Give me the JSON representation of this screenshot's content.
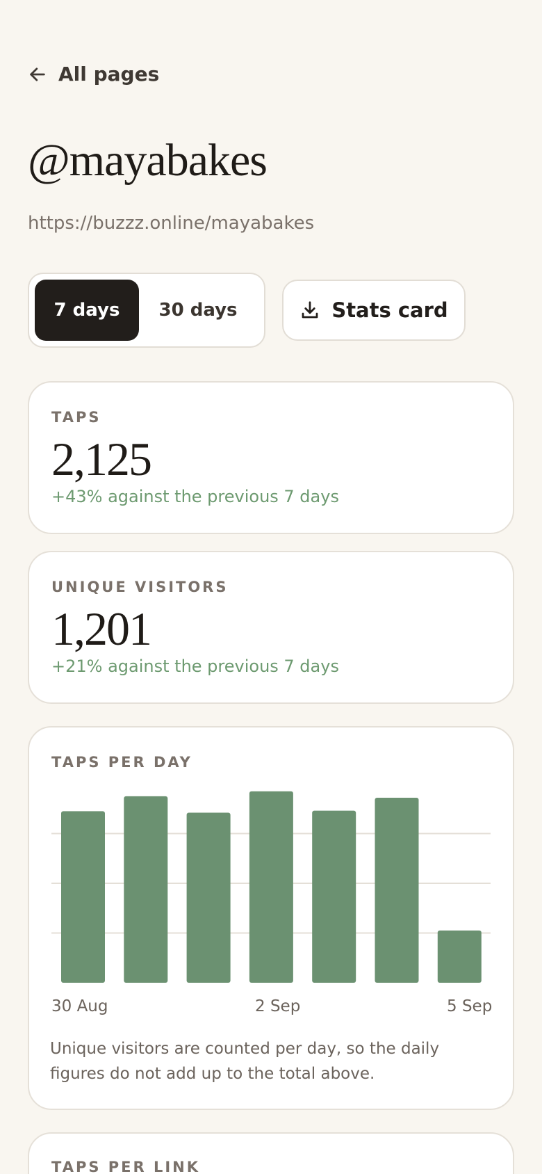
{
  "nav": {
    "back_label": "All pages"
  },
  "page": {
    "handle": "@mayabakes",
    "url": "https://buzzz.online/mayabakes"
  },
  "range": {
    "options": [
      "7 days",
      "30 days"
    ],
    "selected": "7 days"
  },
  "stats_card_button": "Stats card",
  "taps": {
    "label": "TAPS",
    "value": "2,125",
    "delta": "+43% against the previous 7 days"
  },
  "visitors": {
    "label": "UNIQUE VISITORS",
    "value": "1,201",
    "delta": "+21% against the previous 7 days"
  },
  "taps_per_day": {
    "label": "TAPS PER DAY",
    "note": "Unique visitors are counted per day, so the daily figures do not add up to the total above."
  },
  "taps_per_link": {
    "label": "TAPS PER LINK"
  },
  "colors": {
    "bar": "#6b9171",
    "positive": "#6d9a70",
    "dark": "#221e1b"
  },
  "chart_data": {
    "type": "bar",
    "categories": [
      "30 Aug",
      "31 Aug",
      "1 Sep",
      "2 Sep",
      "3 Sep",
      "4 Sep",
      "5 Sep"
    ],
    "tick_labels": [
      "30 Aug",
      "2 Sep",
      "5 Sep"
    ],
    "values": [
      345,
      375,
      342,
      385,
      346,
      372,
      105
    ],
    "ylim": [
      0,
      400
    ],
    "gridlines": [
      100,
      200,
      300
    ],
    "grid": true
  }
}
